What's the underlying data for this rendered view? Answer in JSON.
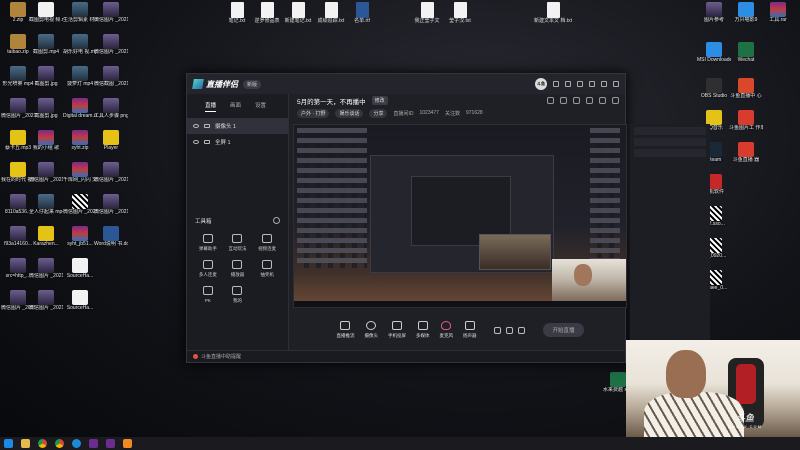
{
  "desktop": {
    "col1": [
      "2.zip",
      "taibao.zip",
      "形光喷雾\nmp4",
      "微信图片\n_202108...",
      "蔡卡丘.mp3",
      "我在的时代\n视频.mp3",
      "8110a536...",
      "f93a14160...",
      "src=http_...",
      "微信图片\n_202106..."
    ],
    "col2": [
      "截图剪电视\n频.mp4",
      "截图剪.mp4",
      "截图剪.jpg",
      "截图剪.jpg",
      "我的小组\n歌",
      "微信图片\n_202106...",
      "全人仔起来\nmp4",
      "Karazhen...",
      "微信图片\n_202107...",
      "微信图片\n_202108..."
    ],
    "col3": [
      "生活剪辑素\n材.mp4",
      "胡乐好电\n视.mp4",
      "菠萝灯\nmp4",
      "Digital\ndream.rar",
      "syht.zip",
      "千库网_闪闪\n文字.zip",
      "微信图片\n_202106...",
      "syht_jb51...",
      "SourceHa...",
      "SourceHa..."
    ],
    "col4": [
      "微信图片\n_2021071...",
      "微信图片\n_2021042...",
      "微信截图\n_202108...",
      "工具人步骤\npng",
      "Player",
      "微信图片\n_202108...",
      "微信图片\n_202106...",
      "Word说明\n书.docx",
      "",
      ""
    ],
    "top_files": [
      "笔记.txt",
      "逆罗修品表",
      "新建笔记.txt",
      "成绩追踪.txt",
      "名单.rtf",
      "我正莹子文\n",
      "莹子汉.txt",
      "新建文本文\n档.txt"
    ],
    "right_col1": [
      "图片参考",
      "MSI\nDownloader",
      "OBS Studio",
      "QQ音乐",
      "Steam",
      "卡机软件",
      "502.sso...",
      "wrj_0920...",
      "502aee_0..."
    ],
    "right_col2": [
      "万兴喵影9",
      "Wechat",
      "斗鱼直播中\n心",
      "斗鱼图片工\n作单",
      "斗鱼直播\n器",
      "",
      "",
      "",
      ""
    ],
    "right_col3": [
      "工具.rar",
      "",
      "",
      "",
      "",
      "",
      "",
      "",
      ""
    ],
    "bottom_right": "水来费越\nxlsx"
  },
  "app": {
    "logo": "直播伴侣",
    "version": "新版",
    "avatar_text": "斗鱼",
    "left_tabs": [
      "直播",
      "画面",
      "设置"
    ],
    "sources": [
      "摄像头 1",
      "全屏 1"
    ],
    "tools_label": "工具箱",
    "tools": [
      "弹幕助手",
      "互动玩法",
      "视频连麦",
      "多人连麦",
      "播放器",
      "抽奖机",
      "PK",
      "我的"
    ],
    "stream_title": "5月的第一天，不再播中",
    "edit_label": "修改",
    "meta": {
      "category": "户外 · 打野",
      "tags": "娱乐谈话",
      "share": "分享",
      "room_label": "直播间ID",
      "room_id": "1023477",
      "fans_label": "关注数",
      "fans": "971628"
    },
    "bottom_tools": [
      "直播推流",
      "摄像头",
      "手机投屏",
      "多媒体",
      "麦克风",
      "扬声器"
    ],
    "live_button": "开始直播",
    "status": "斗鱼直播中助提醒"
  },
  "webcam": {
    "watermark_top": "斗鱼",
    "watermark_bottom": "DOUYU.COM"
  }
}
